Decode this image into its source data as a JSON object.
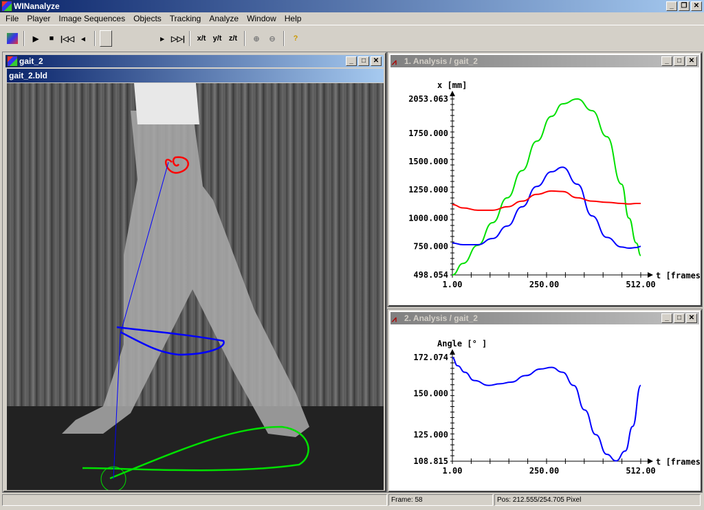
{
  "app": {
    "title": "WINanalyze"
  },
  "menu": [
    "File",
    "Player",
    "Image Sequences",
    "Objects",
    "Tracking",
    "Analyze",
    "Window",
    "Help"
  ],
  "toolbar": {
    "buttons": [
      {
        "icon": "open-icon"
      },
      {
        "icon": "play-icon",
        "glyph": "▶"
      },
      {
        "icon": "stop-icon",
        "glyph": "■"
      },
      {
        "icon": "first-frame-icon",
        "glyph": "|◁◁"
      },
      {
        "icon": "step-back-icon",
        "glyph": "◂"
      },
      {
        "icon": "step-forward-icon",
        "glyph": "▸"
      },
      {
        "icon": "last-frame-icon",
        "glyph": "▷▷|"
      },
      {
        "icon": "xt-plot-icon",
        "glyph": "x/t"
      },
      {
        "icon": "yt-plot-icon",
        "glyph": "y/t"
      },
      {
        "icon": "zt-plot-icon",
        "glyph": "z/t"
      },
      {
        "icon": "zoom-in-icon",
        "glyph": "⊕"
      },
      {
        "icon": "zoom-out-icon",
        "glyph": "⊖"
      },
      {
        "icon": "help-icon",
        "glyph": "?"
      }
    ]
  },
  "video_window": {
    "title": "gait_2",
    "subtitle": "gait_2.bld"
  },
  "chart_windows": [
    {
      "title": "1. Analysis / gait_2"
    },
    {
      "title": "2. Analysis / gait_2"
    }
  ],
  "chart_data": [
    {
      "type": "line",
      "ylabel": "x [mm]",
      "xlabel": "t [frames]",
      "xlim": [
        1,
        512
      ],
      "ylim": [
        498.054,
        2053.063
      ],
      "xticks": [
        "1.00",
        "250.00",
        "512.00"
      ],
      "yticks": [
        "2053.063",
        "1750.000",
        "1500.000",
        "1250.000",
        "1000.000",
        "750.000",
        "498.054"
      ],
      "x": [
        1,
        30,
        70,
        110,
        150,
        190,
        230,
        270,
        300,
        340,
        380,
        420,
        460,
        480,
        500,
        512
      ],
      "series": [
        {
          "color": "#00e000",
          "values": [
            498,
            600,
            760,
            960,
            1180,
            1420,
            1680,
            1900,
            2010,
            2053,
            1950,
            1720,
            1300,
            1000,
            780,
            670
          ]
        },
        {
          "color": "#0000ff",
          "values": [
            780,
            765,
            765,
            820,
            930,
            1100,
            1280,
            1410,
            1450,
            1300,
            1020,
            830,
            745,
            735,
            740,
            750
          ]
        },
        {
          "color": "#ff0000",
          "values": [
            1120,
            1090,
            1070,
            1070,
            1100,
            1150,
            1210,
            1240,
            1235,
            1180,
            1150,
            1140,
            1130,
            1125,
            1130,
            1130
          ]
        }
      ]
    },
    {
      "type": "line",
      "ylabel": "Angle [° ]",
      "xlabel": "t [frames]",
      "xlim": [
        1,
        512
      ],
      "ylim": [
        108.815,
        172.074
      ],
      "xticks": [
        "1.00",
        "250.00",
        "512.00"
      ],
      "yticks": [
        "172.074",
        "150.000",
        "125.000",
        "108.815"
      ],
      "x": [
        1,
        15,
        35,
        60,
        100,
        130,
        160,
        200,
        240,
        270,
        300,
        330,
        360,
        390,
        420,
        445,
        470,
        490,
        512
      ],
      "series": [
        {
          "color": "#0000ff",
          "values": [
            172,
            167,
            163,
            158,
            155,
            156,
            157,
            161,
            165,
            166,
            163,
            155,
            140,
            125,
            113,
            109,
            115,
            130,
            155
          ]
        }
      ]
    }
  ],
  "status": {
    "frame": "Frame: 58",
    "pos": "Pos: 212.555/254.705 Pixel"
  }
}
